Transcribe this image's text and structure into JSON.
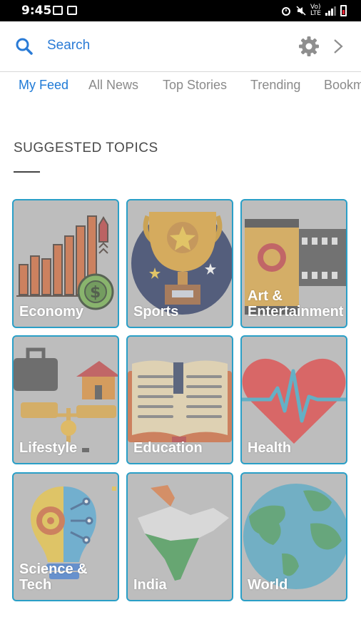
{
  "status_bar": {
    "time": "9:45",
    "net1": "Vo)",
    "net2": "LTE"
  },
  "search": {
    "placeholder": "Search"
  },
  "tabs": [
    {
      "label": "My Feed",
      "active": true
    },
    {
      "label": "All News",
      "active": false
    },
    {
      "label": "Top Stories",
      "active": false
    },
    {
      "label": "Trending",
      "active": false
    },
    {
      "label": "Bookmarks",
      "active": false
    }
  ],
  "section": {
    "title": "SUGGESTED TOPICS"
  },
  "topics": [
    {
      "label": "Economy",
      "icon": "economy-icon"
    },
    {
      "label": "Sports",
      "icon": "trophy-icon"
    },
    {
      "label": "Art & Entertainment",
      "icon": "film-icon"
    },
    {
      "label": "Lifestyle",
      "icon": "lifestyle-icon"
    },
    {
      "label": "Education",
      "icon": "book-icon"
    },
    {
      "label": "Health",
      "icon": "heart-icon"
    },
    {
      "label": "Science & Tech",
      "icon": "lightbulb-icon"
    },
    {
      "label": "India",
      "icon": "india-map-icon"
    },
    {
      "label": "World",
      "icon": "globe-icon"
    }
  ],
  "colors": {
    "accent": "#1f7ad6",
    "tile_border": "#2a9fc7",
    "tile_bg": "#bdbdbd"
  }
}
